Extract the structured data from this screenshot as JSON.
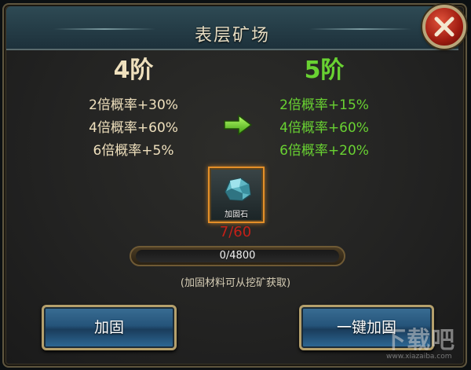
{
  "title": "表层矿场",
  "current_level": {
    "label": "4阶",
    "rates": [
      "2倍概率+30%",
      "4倍概率+60%",
      "6倍概率+5%"
    ]
  },
  "next_level": {
    "label": "5阶",
    "rates": [
      "2倍概率+15%",
      "4倍概率+60%",
      "6倍概率+20%"
    ]
  },
  "material": {
    "name": "加固石",
    "count": "7/60",
    "icon": "crystal-ore-icon"
  },
  "progress": {
    "text": "0/4800",
    "fraction": 0
  },
  "hint": "(加固材料可从挖矿获取)",
  "buttons": {
    "reinforce": "加固",
    "one_click": "一键加固"
  },
  "watermark": {
    "brand": "下载吧",
    "url": "www.xiazaiba.com"
  },
  "colors": {
    "current": "#efe0bd",
    "next": "#69d232",
    "count": "#c42018"
  }
}
